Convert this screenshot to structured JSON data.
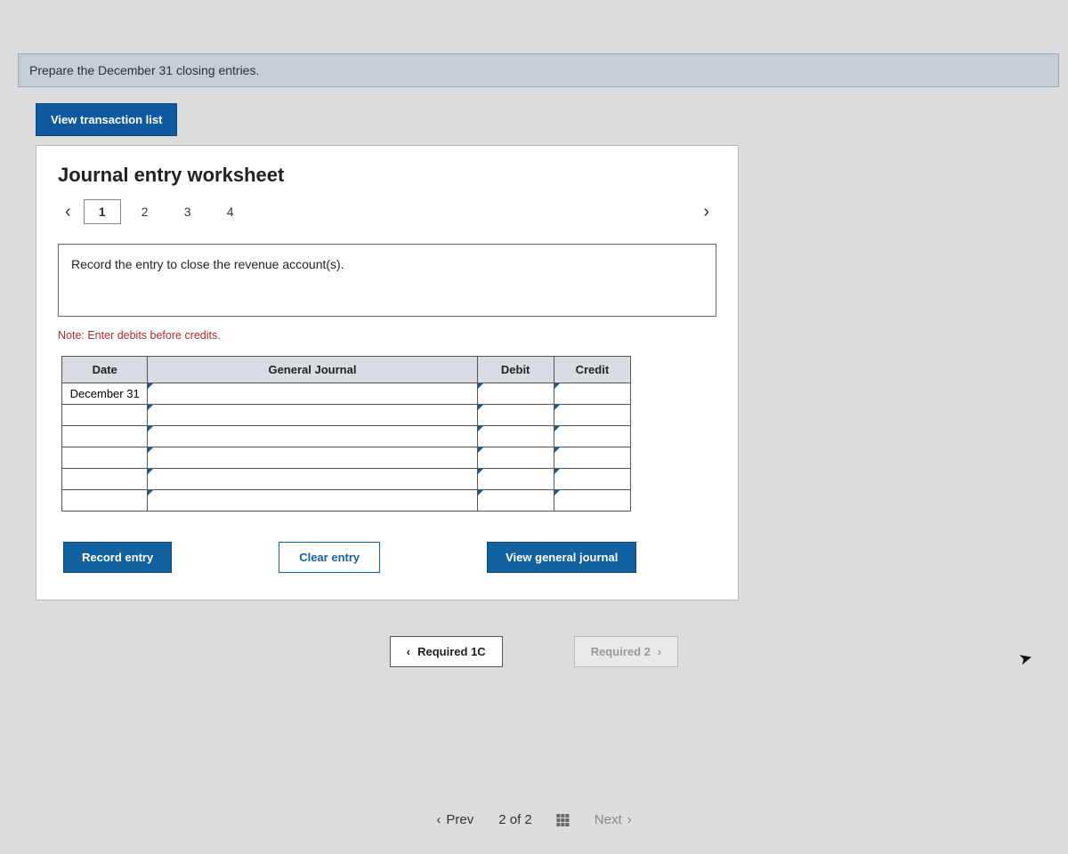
{
  "instruction": "Prepare the December 31 closing entries.",
  "buttons": {
    "view_transaction": "View transaction list",
    "record_entry": "Record entry",
    "clear_entry": "Clear entry",
    "view_journal": "View general journal",
    "req_prev": "Required 1C",
    "req_next": "Required 2",
    "prev": "Prev",
    "next": "Next"
  },
  "worksheet": {
    "title": "Journal entry worksheet",
    "tabs": [
      "1",
      "2",
      "3",
      "4"
    ],
    "active_tab": 0,
    "description": "Record the entry to close the revenue account(s).",
    "note": "Note: Enter debits before credits.",
    "columns": {
      "date": "Date",
      "journal": "General Journal",
      "debit": "Debit",
      "credit": "Credit"
    },
    "first_row_date": "December 31"
  },
  "pager": {
    "current": "2",
    "of_word": "of",
    "total": "2"
  }
}
